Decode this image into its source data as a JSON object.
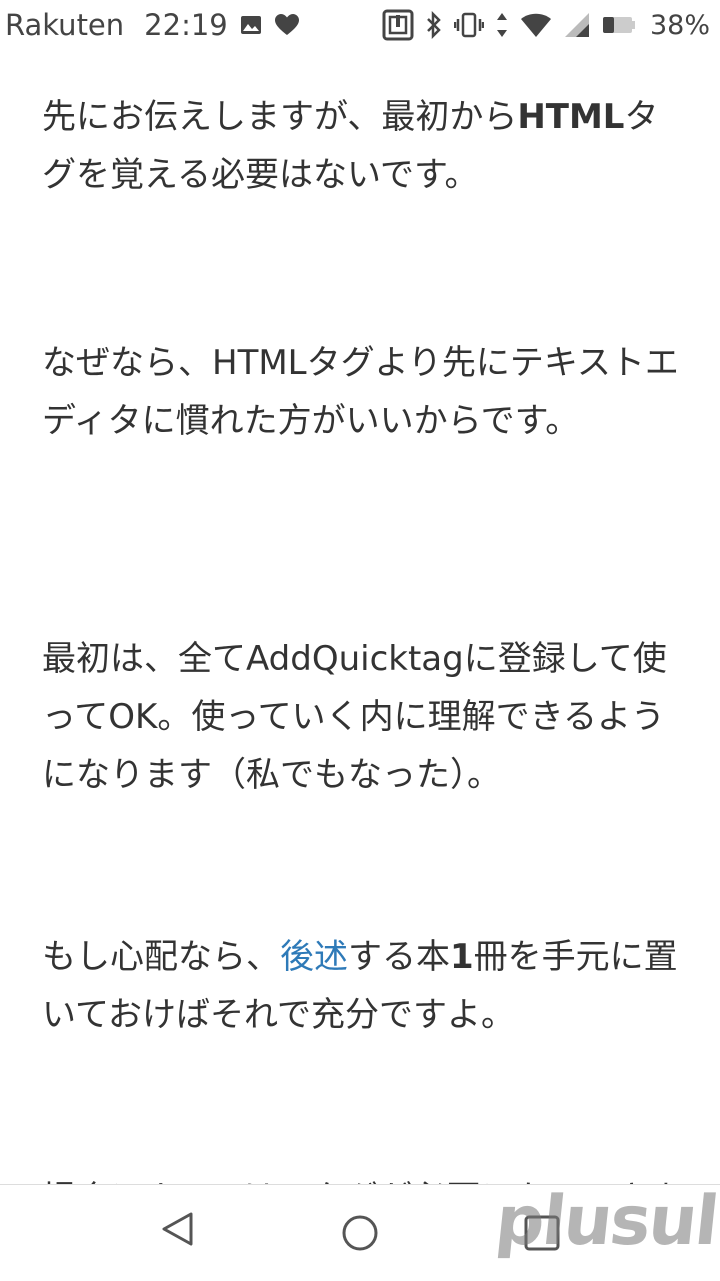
{
  "status_bar": {
    "carrier": "Rakuten",
    "time": "22:19",
    "battery_percent": "38%",
    "battery_level": 0.38,
    "icons": [
      "image-icon",
      "heart-icon",
      "nfc-icon",
      "bluetooth-icon",
      "vibrate-icon",
      "data-arrows-icon",
      "wifi-icon",
      "signal-icon",
      "battery-icon"
    ]
  },
  "article": {
    "p1": {
      "text": "先にお伝えしますが、最初から",
      "strong": "HTML",
      "rest": "タグを覚える必要はないです。"
    },
    "p2": {
      "text": "なぜなら、HTMLタグより先にテキストエディタに慣れた方がいいからです。"
    },
    "p3": {
      "text": "最初は、全てAddQuicktagに登録して使ってOK。使っていく内に理解できるようになります（私でもなった）。"
    },
    "p4": {
      "text": "もし心配なら、",
      "link": "後述",
      "after_link": "する本",
      "strong": "1",
      "rest": "冊を手元に置いておけばそれで充分ですよ。"
    },
    "p5": {
      "text": "場合によっては、タグが必要になってきます"
    }
  },
  "nav_bar": {
    "icons": [
      "back-icon",
      "home-icon",
      "recent-apps-icon"
    ]
  },
  "watermark": {
    "text": "plusul"
  },
  "colors": {
    "link": "#2e7ab8",
    "text": "#333333",
    "status": "#444444"
  }
}
